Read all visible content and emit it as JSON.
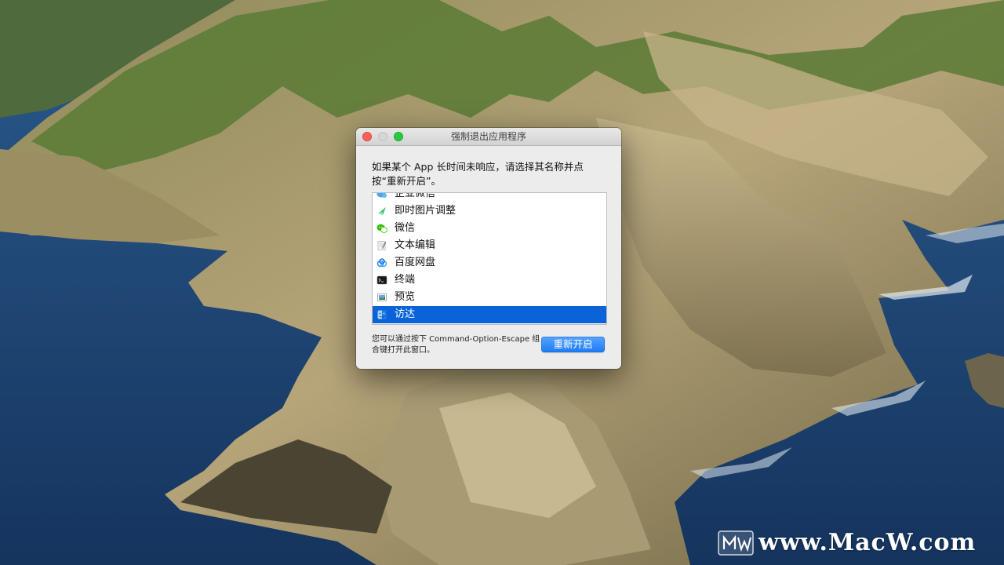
{
  "window": {
    "title": "强制退出应用程序",
    "message": "如果某个 App 长时间未响应，请选择其名称并点按“重新开启”。",
    "apps": [
      {
        "label": "企业微信",
        "icon": "wecom-icon",
        "selected": false
      },
      {
        "label": "即时图片调整",
        "icon": "image-tuner-icon",
        "selected": false
      },
      {
        "label": "微信",
        "icon": "wechat-icon",
        "selected": false
      },
      {
        "label": "文本编辑",
        "icon": "textedit-icon",
        "selected": false
      },
      {
        "label": "百度网盘",
        "icon": "baidu-netdisk-icon",
        "selected": false
      },
      {
        "label": "终端",
        "icon": "terminal-icon",
        "selected": false
      },
      {
        "label": "预览",
        "icon": "preview-icon",
        "selected": false
      },
      {
        "label": "访达",
        "icon": "finder-icon",
        "selected": true
      }
    ],
    "footnote": "您可以通过按下 Command-Option-Escape 组合键打开此窗口。",
    "relaunch_label": "重新开启"
  },
  "watermark": {
    "text": "www.MacW.com"
  },
  "colors": {
    "selection": "#0a63d8",
    "button": "#1b7bf3",
    "close": "#fc5f57",
    "zoom": "#2ac940"
  }
}
